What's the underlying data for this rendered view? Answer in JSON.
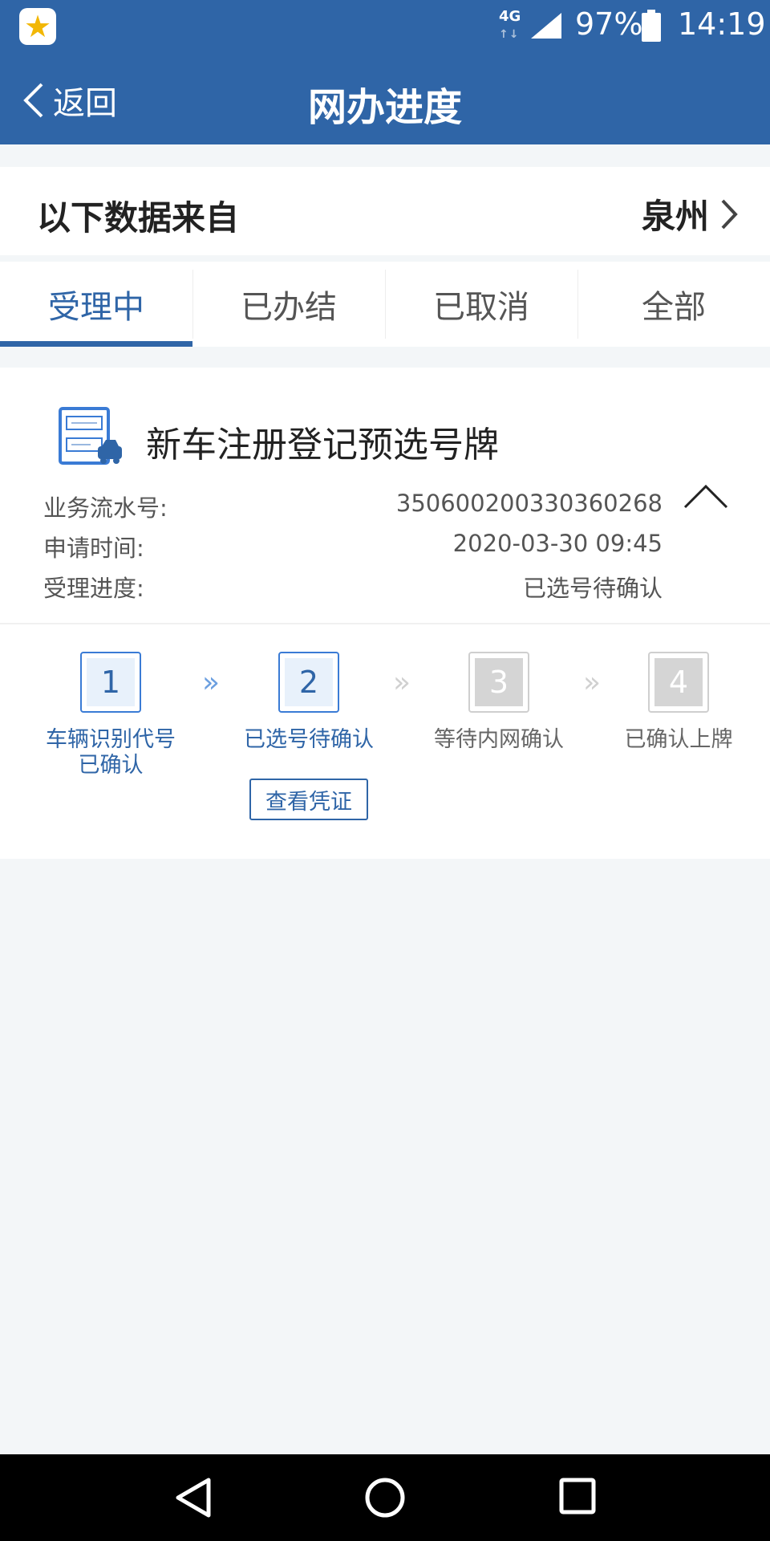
{
  "status_bar": {
    "network": "4G",
    "network_activity": "↑↓",
    "battery": "97%",
    "time": "14:19"
  },
  "nav": {
    "back_label": "返回",
    "title": "网办进度"
  },
  "source": {
    "label": "以下数据来自",
    "city": "泉州"
  },
  "tabs": [
    {
      "label": "受理中",
      "active": true
    },
    {
      "label": "已办结",
      "active": false
    },
    {
      "label": "已取消",
      "active": false
    },
    {
      "label": "全部",
      "active": false
    }
  ],
  "record": {
    "title": "新车注册登记预选号牌",
    "fields": [
      {
        "label": "业务流水号:",
        "value": "350600200330360268"
      },
      {
        "label": "申请时间:",
        "value": "2020-03-30 09:45"
      },
      {
        "label": "受理进度:",
        "value": "已选号待确认"
      }
    ],
    "steps": [
      {
        "number": "1",
        "label_line1": "车辆识别代号",
        "label_line2": "已确认",
        "state": "done"
      },
      {
        "number": "2",
        "label_line1": "已选号待确认",
        "label_line2": "",
        "state": "current"
      },
      {
        "number": "3",
        "label_line1": "等待内网确认",
        "label_line2": "",
        "state": "pending"
      },
      {
        "number": "4",
        "label_line1": "已确认上牌",
        "label_line2": "",
        "state": "pending"
      }
    ],
    "view_voucher_label": "查看凭证"
  },
  "colors": {
    "brand": "#2f65a7",
    "pending_step": "#d5d5d5"
  }
}
